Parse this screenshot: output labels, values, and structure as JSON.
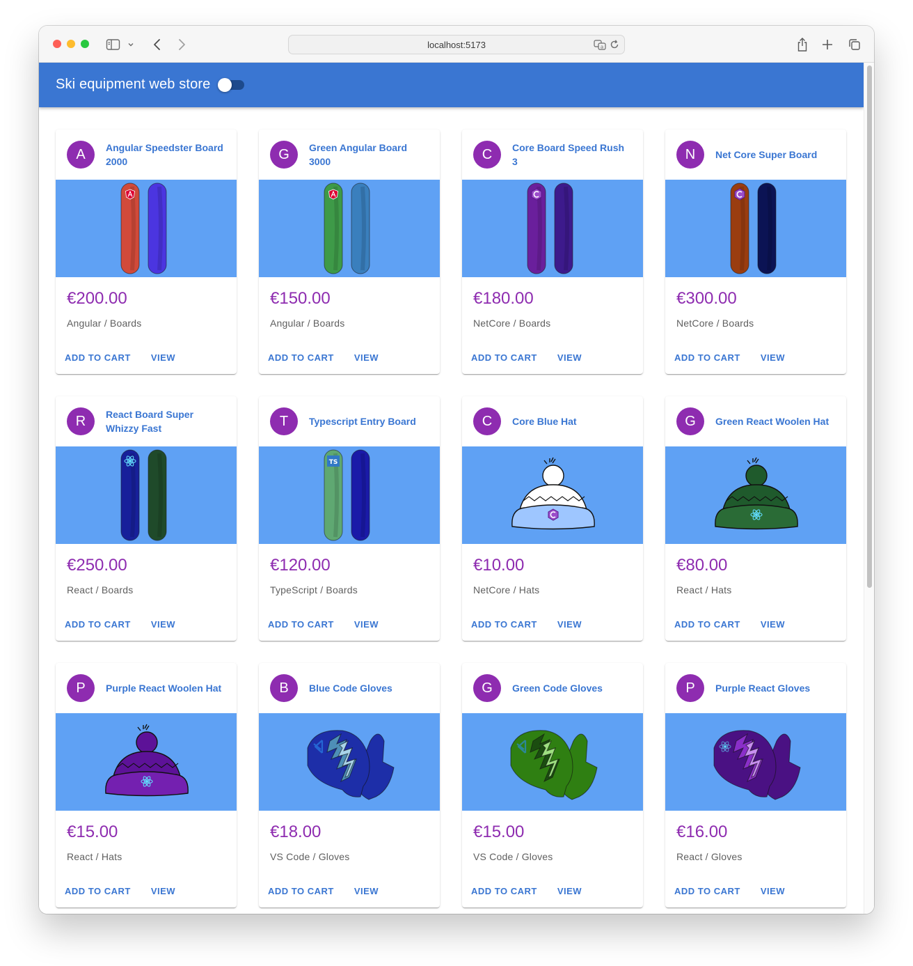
{
  "browser": {
    "url": "localhost:5173"
  },
  "app": {
    "title": "Ski equipment web store",
    "theme_switch_on": false
  },
  "products": [
    {
      "initial": "A",
      "title": "Angular Speedster Board 2000",
      "price": "€200.00",
      "category": "Angular / Boards",
      "kind": "board",
      "colors": [
        "#d14a3a",
        "#4b35e0"
      ],
      "logo": "angular-logo-icon"
    },
    {
      "initial": "G",
      "title": "Green Angular Board 3000",
      "price": "€150.00",
      "category": "Angular / Boards",
      "kind": "board",
      "colors": [
        "#3e9a48",
        "#3a7fbd"
      ],
      "logo": "angular-logo-icon"
    },
    {
      "initial": "C",
      "title": "Core Board Speed Rush 3",
      "price": "€180.00",
      "category": "NetCore / Boards",
      "kind": "board",
      "colors": [
        "#6a1f9c",
        "#3d1a8c"
      ],
      "logo": "dotnet-logo-icon"
    },
    {
      "initial": "N",
      "title": "Net Core Super Board",
      "price": "€300.00",
      "category": "NetCore / Boards",
      "kind": "board",
      "colors": [
        "#9a3d10",
        "#0b1354"
      ],
      "logo": "dotnet-logo-icon"
    },
    {
      "initial": "R",
      "title": "React Board Super Whizzy Fast",
      "price": "€250.00",
      "category": "React / Boards",
      "kind": "board",
      "colors": [
        "#17209a",
        "#1f4a2a"
      ],
      "logo": "react-logo-icon"
    },
    {
      "initial": "T",
      "title": "Typescript Entry Board",
      "price": "€120.00",
      "category": "TypeScript / Boards",
      "kind": "board",
      "colors": [
        "#5fa872",
        "#1a1aa8"
      ],
      "logo": "typescript-logo-icon"
    },
    {
      "initial": "C",
      "title": "Core Blue Hat",
      "price": "€10.00",
      "category": "NetCore / Hats",
      "kind": "hat",
      "colors": [
        "#9ec6ff",
        "#ffffff"
      ],
      "logo": "dotnet-logo-icon"
    },
    {
      "initial": "G",
      "title": "Green React Woolen Hat",
      "price": "€80.00",
      "category": "React / Hats",
      "kind": "hat",
      "colors": [
        "#1f5a2c",
        "#2a6b36"
      ],
      "logo": "react-logo-icon"
    },
    {
      "initial": "P",
      "title": "Purple React Woolen Hat",
      "price": "€15.00",
      "category": "React / Hats",
      "kind": "hat",
      "colors": [
        "#5d1298",
        "#7420b0"
      ],
      "logo": "react-logo-icon"
    },
    {
      "initial": "B",
      "title": "Blue Code Gloves",
      "price": "€18.00",
      "category": "VS Code / Gloves",
      "kind": "gloves",
      "colors": [
        "#1d2ea8",
        "#4e8fb7",
        "#a9d4ea"
      ],
      "logo": "vscode-logo-icon"
    },
    {
      "initial": "G",
      "title": "Green Code Gloves",
      "price": "€15.00",
      "category": "VS Code / Gloves",
      "kind": "gloves",
      "colors": [
        "#2f7f12",
        "#1b4d10",
        "#9ee080"
      ],
      "logo": "vscode-logo-icon"
    },
    {
      "initial": "P",
      "title": "Purple React Gloves",
      "price": "€16.00",
      "category": "React / Gloves",
      "kind": "gloves",
      "colors": [
        "#4a1183",
        "#8a2fc9",
        "#c890f0"
      ],
      "logo": "react-logo-icon"
    }
  ],
  "actions": {
    "add_to_cart": "ADD TO CART",
    "view": "VIEW"
  },
  "colors": {
    "appbar": "#3a76d2",
    "accent_purple": "#8e2cb0",
    "media_background": "#5fa1f4"
  }
}
